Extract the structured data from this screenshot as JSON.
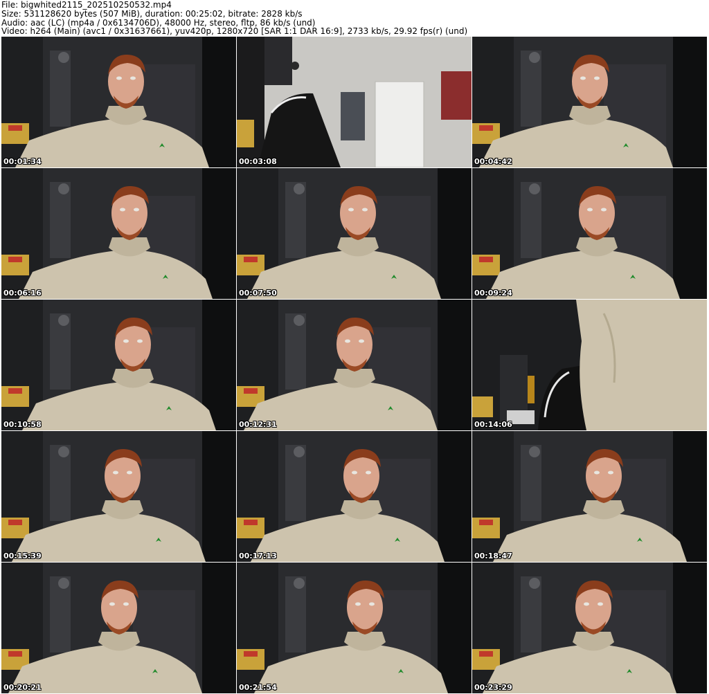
{
  "header": {
    "file": "File: bigwhited2115_202510250532.mp4",
    "size": "Size: 531128620 bytes (507 MiB), duration: 00:25:02, bitrate: 2828 kb/s",
    "audio": "Audio: aac (LC) (mp4a / 0x6134706D), 48000 Hz, stereo, fltp, 86 kb/s (und)",
    "video": "Video: h264 (Main) (avc1 / 0x31637661), yuv420p, 1280x720 [SAR 1:1 DAR 16:9], 2733 kb/s, 29.92 fps(r) (und)"
  },
  "thumbnails": [
    {
      "timestamp": "00:01:34",
      "scene": "person"
    },
    {
      "timestamp": "00:03:08",
      "scene": "room-chair"
    },
    {
      "timestamp": "00:04:42",
      "scene": "person"
    },
    {
      "timestamp": "00:06:16",
      "scene": "person"
    },
    {
      "timestamp": "00:07:50",
      "scene": "person"
    },
    {
      "timestamp": "00:09:24",
      "scene": "person"
    },
    {
      "timestamp": "00:10:58",
      "scene": "person"
    },
    {
      "timestamp": "00:12:31",
      "scene": "person"
    },
    {
      "timestamp": "00:14:06",
      "scene": "closeup-hoodie"
    },
    {
      "timestamp": "00:15:39",
      "scene": "person"
    },
    {
      "timestamp": "00:17:13",
      "scene": "person"
    },
    {
      "timestamp": "00:18:47",
      "scene": "person"
    },
    {
      "timestamp": "00:20:21",
      "scene": "person"
    },
    {
      "timestamp": "00:21:54",
      "scene": "person"
    },
    {
      "timestamp": "00:23:29",
      "scene": "person"
    }
  ],
  "colors": {
    "hoodie": "#cdc3ad",
    "hair": "#8a3d1c",
    "skin": "#d9a48c",
    "wall": "#2a2b2e",
    "leaf": "#1f8a2a"
  }
}
